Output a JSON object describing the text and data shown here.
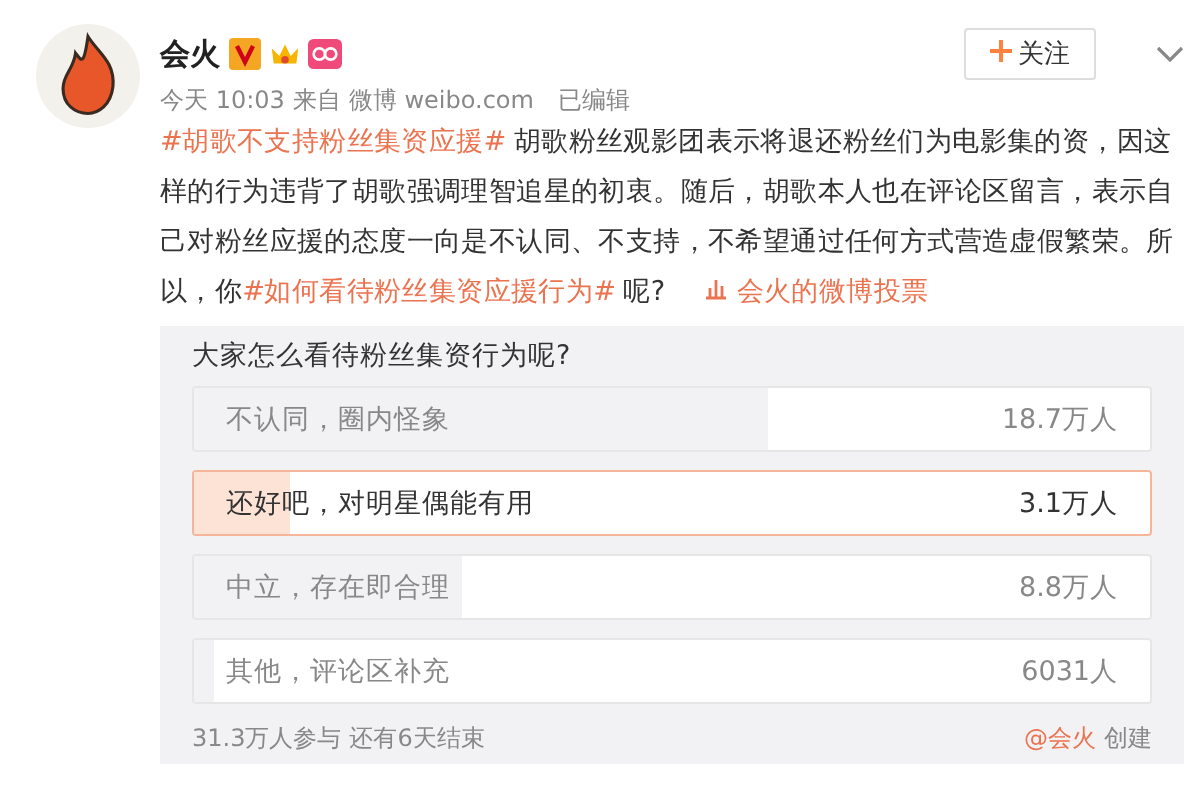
{
  "post": {
    "author": "会火",
    "follow_label": "关注",
    "time": "今天 10:03",
    "source_prefix": "来自",
    "source": "微博 weibo.com",
    "edited": "已编辑",
    "body": [
      {
        "kind": "hashtag",
        "text": "#胡歌不支持粉丝集资应援#"
      },
      {
        "kind": "text",
        "text": " 胡歌粉丝观影团表示将退还粉丝们为电影集的资，因这样的行为违背了胡歌强调理智追星的初衷。随后，胡歌本人也在评论区留言，表示自己对粉丝应援的态度一向是不认同、不支持，不希望通过任何方式营造虚假繁荣。所以，你"
      },
      {
        "kind": "hashtag",
        "text": "#如何看待粉丝集资应援行为#"
      },
      {
        "kind": "text",
        "text": " 呢?"
      }
    ],
    "poll_link": "会火的微博投票"
  },
  "poll": {
    "question": "大家怎么看待粉丝集资行为呢?",
    "options": [
      {
        "label": "不认同，圈内怪象",
        "count": "18.7万人",
        "level": 0.6,
        "selected": false
      },
      {
        "label": "还好吧，对明星偶能有用",
        "count": "3.1万人",
        "level": 0.1,
        "selected": true
      },
      {
        "label": "中立，存在即合理",
        "count": "8.8万人",
        "level": 0.28,
        "selected": false
      },
      {
        "label": "其他，评论区补充",
        "count": "6031人",
        "level": 0.02,
        "selected": false
      }
    ],
    "participants": "31.3万人参与",
    "remaining": "还有6天结束",
    "creator": "@会火",
    "created": "创建"
  }
}
